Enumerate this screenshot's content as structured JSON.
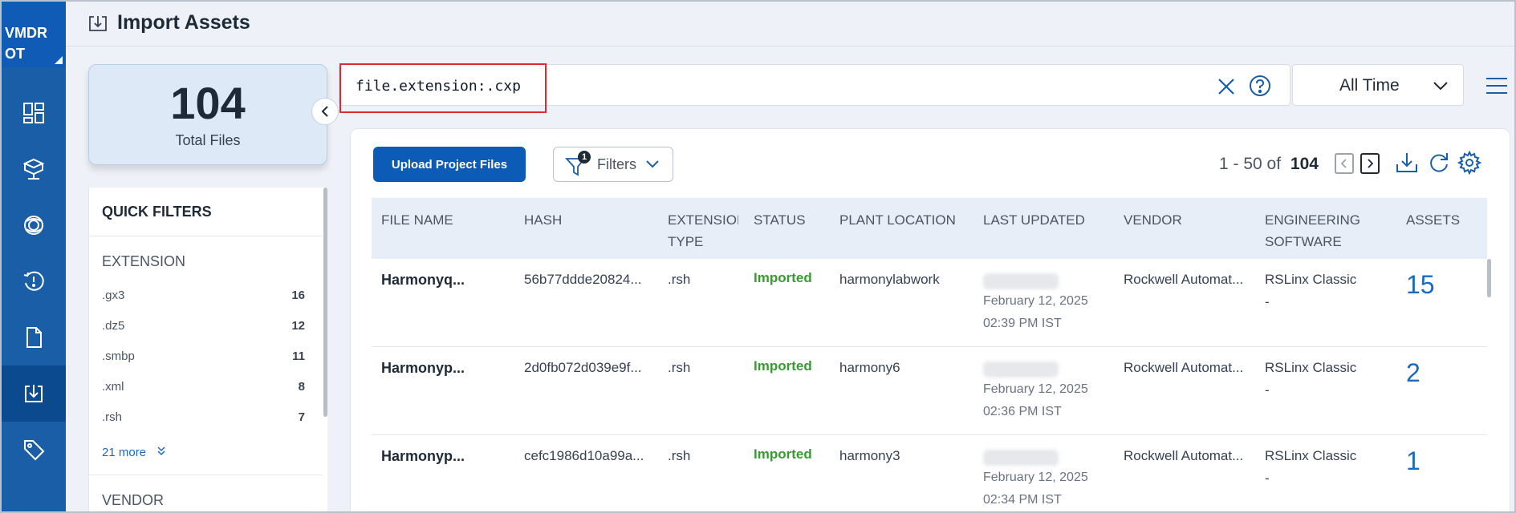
{
  "nav": {
    "brand_line1": "VMDR",
    "brand_line2": "OT",
    "items": [
      {
        "icon": "dashboard-icon"
      },
      {
        "icon": "assets-icon"
      },
      {
        "icon": "vulnerabilities-icon"
      },
      {
        "icon": "activity-icon"
      },
      {
        "icon": "files-icon"
      },
      {
        "icon": "import-icon",
        "active": true
      },
      {
        "icon": "tags-icon"
      }
    ]
  },
  "header": {
    "title": "Import Assets"
  },
  "summary": {
    "count": "104",
    "label": "Total Files"
  },
  "quick_filters": {
    "title": "QUICK FILTERS",
    "extension_heading": "EXTENSION",
    "extensions": [
      {
        "value": ".gx3",
        "count": "16"
      },
      {
        "value": ".dz5",
        "count": "12"
      },
      {
        "value": ".smbp",
        "count": "11"
      },
      {
        "value": ".xml",
        "count": "8"
      },
      {
        "value": ".rsh",
        "count": "7"
      }
    ],
    "more_label": "21 more",
    "vendor_heading": "VENDOR"
  },
  "search": {
    "value": "file.extension:.cxp"
  },
  "time_filter": {
    "selected": "All Time"
  },
  "toolbar": {
    "upload_label": "Upload Project Files",
    "filters_label": "Filters",
    "filters_badge": "1",
    "range": "1 - 50 of",
    "total": "104"
  },
  "table": {
    "headers": {
      "file_name": "FILE NAME",
      "hash": "HASH",
      "ext1": "EXTENSION",
      "ext2": "TYPE",
      "status": "STATUS",
      "plant": "PLANT LOCATION",
      "updated": "LAST UPDATED",
      "vendor": "VENDOR",
      "eng1": "ENGINEERING",
      "eng2": "SOFTWARE",
      "assets": "ASSETS"
    },
    "rows": [
      {
        "file_name": "Harmonyq...",
        "hash": "56b77ddde20824...",
        "ext": ".rsh",
        "status": "Imported",
        "plant": "harmonylabwork",
        "date": "February 12, 2025",
        "time": "02:39 PM IST",
        "vendor": "Rockwell Automat...",
        "software": "RSLinx Classic",
        "software_sub": "-",
        "assets": "15"
      },
      {
        "file_name": "Harmonyp...",
        "hash": "2d0fb072d039e9f...",
        "ext": ".rsh",
        "status": "Imported",
        "plant": "harmony6",
        "date": "February 12, 2025",
        "time": "02:36 PM IST",
        "vendor": "Rockwell Automat...",
        "software": "RSLinx Classic",
        "software_sub": "-",
        "assets": "2"
      },
      {
        "file_name": "Harmonyp...",
        "hash": "cefc1986d10a99a...",
        "ext": ".rsh",
        "status": "Imported",
        "plant": "harmony3",
        "date": "February 12, 2025",
        "time": "02:34 PM IST",
        "vendor": "Rockwell Automat...",
        "software": "RSLinx Classic",
        "software_sub": "-",
        "assets": "1"
      }
    ]
  },
  "colors": {
    "nav_bg": "#1a5ea8",
    "primary": "#0c5bb6",
    "status_imported": "#3a9a33",
    "search_highlight": "#e0282e"
  }
}
